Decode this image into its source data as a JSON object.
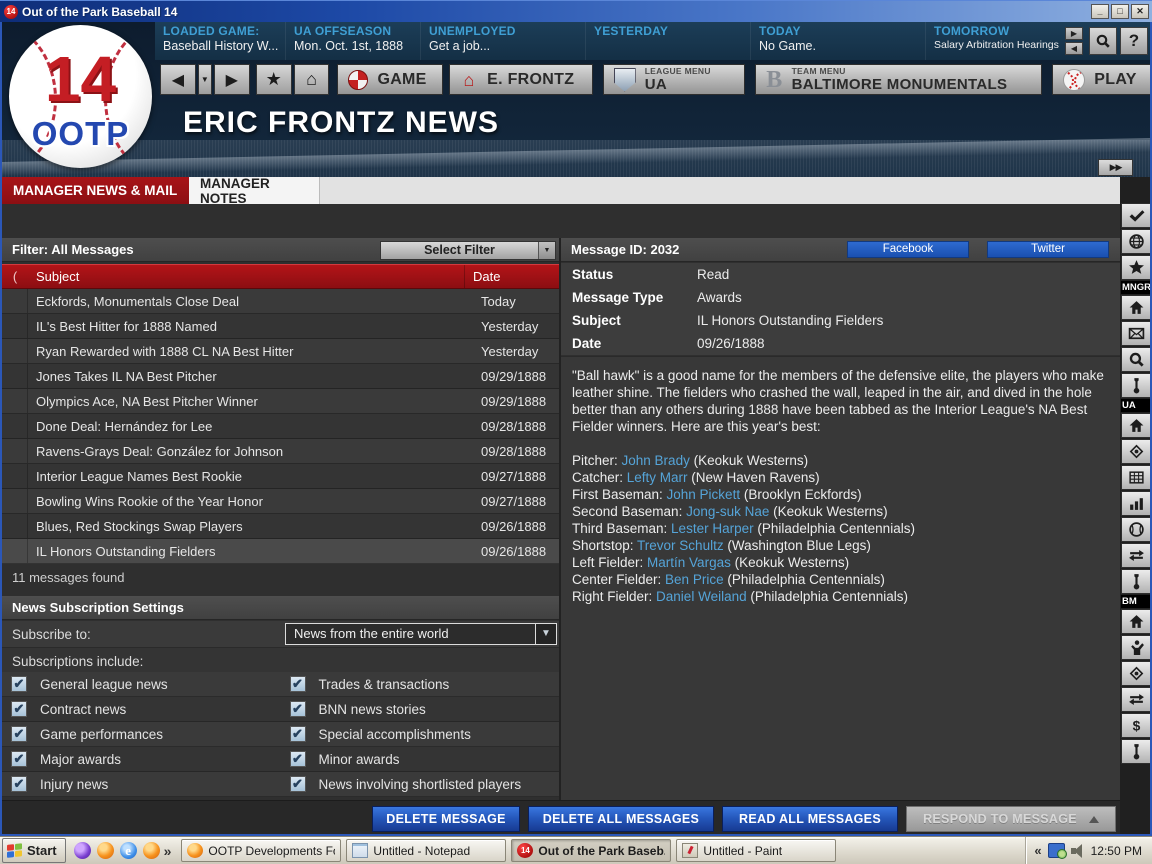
{
  "window": {
    "title": "Out of the Park Baseball 14",
    "icon_number": "14"
  },
  "topbar": {
    "columns": [
      {
        "label": "LOADED GAME:",
        "value": "Baseball History W..."
      },
      {
        "label": "UA OFFSEASON",
        "value": "Mon. Oct. 1st, 1888"
      },
      {
        "label": "UNEMPLOYED",
        "value": "Get a job..."
      },
      {
        "label": "YESTERDAY",
        "value": ""
      },
      {
        "label": "TODAY",
        "value": "No Game."
      },
      {
        "label": "TOMORROW",
        "value": "Salary Arbitration Hearings",
        "small": true
      }
    ]
  },
  "nav": {
    "game_label": "GAME",
    "manager_label": "E. FRONTZ",
    "league_caption": "LEAGUE MENU",
    "league_value": "UA",
    "team_caption": "TEAM MENU",
    "team_value": "BALTIMORE MONUMENTALS",
    "play_label": "PLAY"
  },
  "header": {
    "title": "ERIC FRONTZ NEWS",
    "logo_number": "14",
    "logo_text": "OOTP"
  },
  "tabs": [
    {
      "label": "MANAGER NEWS & MAIL",
      "active": true
    },
    {
      "label": "MANAGER NOTES",
      "active": false
    }
  ],
  "messages": {
    "filter_label": "Filter: All Messages",
    "select_filter_label": "Select Filter",
    "columns": {
      "status_glyph": "(",
      "subject": "Subject",
      "date": "Date"
    },
    "rows": [
      {
        "subject": "Eckfords, Monumentals Close Deal",
        "date": "Today"
      },
      {
        "subject": "IL's Best Hitter for 1888 Named",
        "date": "Yesterday"
      },
      {
        "subject": "Ryan Rewarded with 1888 CL NA Best Hitter",
        "date": "Yesterday"
      },
      {
        "subject": "Jones Takes IL NA Best Pitcher",
        "date": "09/29/1888"
      },
      {
        "subject": "Olympics Ace, NA Best Pitcher Winner",
        "date": "09/29/1888"
      },
      {
        "subject": "Done Deal: Hernández for Lee",
        "date": "09/28/1888"
      },
      {
        "subject": "Ravens-Grays Deal: González for Johnson",
        "date": "09/28/1888"
      },
      {
        "subject": "Interior League Names Best Rookie",
        "date": "09/27/1888"
      },
      {
        "subject": "Bowling Wins Rookie of the Year Honor",
        "date": "09/27/1888"
      },
      {
        "subject": "Blues, Red Stockings Swap Players",
        "date": "09/26/1888"
      },
      {
        "subject": "IL Honors Outstanding Fielders",
        "date": "09/26/1888",
        "selected": true
      }
    ],
    "footer": "11 messages found"
  },
  "subscriptions": {
    "header": "News Subscription Settings",
    "subscribe_label": "Subscribe to:",
    "dropdown_value": "News from the entire world",
    "include_label": "Subscriptions include:",
    "left": [
      "General league news",
      "Contract news",
      "Game performances",
      "Major awards",
      "Injury news"
    ],
    "right": [
      "Trades & transactions",
      "BNN news stories",
      "Special accomplishments",
      "Minor awards",
      "News involving shortlisted players"
    ]
  },
  "message": {
    "id_label": "Message ID: 2032",
    "facebook_label": "Facebook",
    "twitter_label": "Twitter",
    "fields": [
      {
        "label": "Status",
        "value": "Read"
      },
      {
        "label": "Message Type",
        "value": "Awards"
      },
      {
        "label": "Subject",
        "value": "IL Honors Outstanding Fielders"
      },
      {
        "label": "Date",
        "value": "09/26/1888"
      }
    ],
    "body_intro": "\"Ball hawk\" is a good name for the members of the defensive elite, the players who make leather shine. The fielders who crashed the wall, leaped in the air, and dived in the hole better than any others during 1888 have been tabbed as the Interior League's NA Best Fielder winners. Here are this year's best:",
    "winners": [
      {
        "position": "Pitcher",
        "player": "John Brady",
        "team": "Keokuk Westerns"
      },
      {
        "position": "Catcher",
        "player": "Lefty Marr",
        "team": "New Haven Ravens"
      },
      {
        "position": "First Baseman",
        "player": "John Pickett",
        "team": "Brooklyn Eckfords"
      },
      {
        "position": "Second Baseman",
        "player": "Jong-suk Nae",
        "team": "Keokuk Westerns"
      },
      {
        "position": "Third Baseman",
        "player": "Lester Harper",
        "team": "Philadelphia Centennials"
      },
      {
        "position": "Shortstop",
        "player": "Trevor Schultz",
        "team": "Washington Blue Legs"
      },
      {
        "position": "Left Fielder",
        "player": "Martín Vargas",
        "team": "Keokuk Westerns"
      },
      {
        "position": "Center Fielder",
        "player": "Ben Price",
        "team": "Philadelphia Centennials"
      },
      {
        "position": "Right Fielder",
        "player": "Daniel Weiland",
        "team": "Philadelphia Centennials"
      }
    ]
  },
  "actions": {
    "delete_message": "DELETE MESSAGE",
    "delete_all": "DELETE ALL MESSAGES",
    "read_all": "READ ALL MESSAGES",
    "respond": "RESPOND TO MESSAGE"
  },
  "sidebar": {
    "items": [
      {
        "type": "button",
        "icon": "check"
      },
      {
        "type": "button",
        "icon": "globe"
      },
      {
        "type": "button",
        "icon": "star"
      },
      {
        "type": "label",
        "text": "MNGR"
      },
      {
        "type": "button",
        "icon": "home"
      },
      {
        "type": "button",
        "icon": "mail"
      },
      {
        "type": "button",
        "icon": "search"
      },
      {
        "type": "button",
        "icon": "wrench"
      },
      {
        "type": "label",
        "text": "UA"
      },
      {
        "type": "button",
        "icon": "home"
      },
      {
        "type": "button",
        "icon": "field"
      },
      {
        "type": "button",
        "icon": "grid"
      },
      {
        "type": "button",
        "icon": "chart"
      },
      {
        "type": "button",
        "icon": "baseball"
      },
      {
        "type": "button",
        "icon": "swap"
      },
      {
        "type": "button",
        "icon": "wrench"
      },
      {
        "type": "label",
        "text": "BM"
      },
      {
        "type": "button",
        "icon": "home"
      },
      {
        "type": "button",
        "icon": "coach"
      },
      {
        "type": "button",
        "icon": "field"
      },
      {
        "type": "button",
        "icon": "swap"
      },
      {
        "type": "button",
        "icon": "dollar"
      },
      {
        "type": "button",
        "icon": "wrench"
      }
    ]
  },
  "taskbar": {
    "start_label": "Start",
    "quick_launch": [
      "swirl",
      "firefox",
      "ie",
      "firefox"
    ],
    "tasks": [
      {
        "icon": "firefox",
        "label": "OOTP Developments For..."
      },
      {
        "icon": "notepad",
        "label": "Untitled - Notepad"
      },
      {
        "icon": "ootp",
        "label": "Out of the Park Baseb...",
        "active": true
      },
      {
        "icon": "paint",
        "label": "Untitled - Paint"
      }
    ],
    "clock": "12:50 PM"
  },
  "colors": {
    "tab_red": "#9a1115",
    "table_header_red": "#a31317",
    "link_blue": "#55a4d8",
    "action_blue": "#2558bc",
    "social_blue": "#1a50b0",
    "topbar_label_cyan": "#3f9fd4"
  }
}
